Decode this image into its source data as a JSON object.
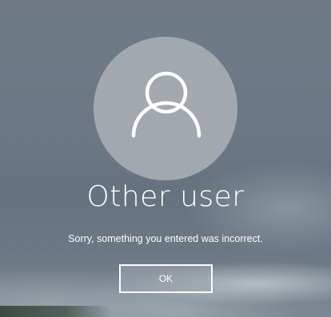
{
  "login": {
    "user_name": "Other user",
    "error_message": "Sorry, something you entered was incorrect.",
    "ok_label": "OK"
  },
  "avatar": {
    "icon": "user-icon"
  },
  "colors": {
    "avatar_circle": "#a2a8ae",
    "text": "#ffffff",
    "button_border": "#ffffff"
  }
}
